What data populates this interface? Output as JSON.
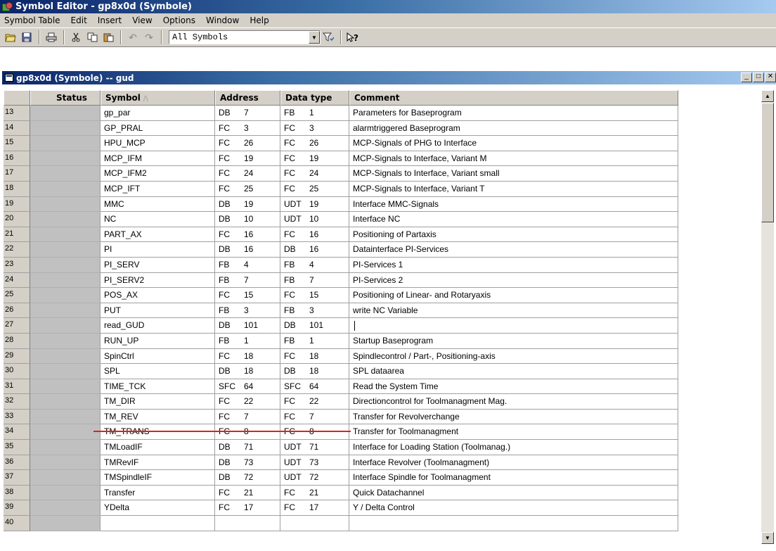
{
  "window": {
    "title": "Symbol Editor - gp8x0d (Symbole)"
  },
  "menu": [
    "Symbol Table",
    "Edit",
    "Insert",
    "View",
    "Options",
    "Window",
    "Help"
  ],
  "toolbar": {
    "filter_value": "All Symbols"
  },
  "child_window": {
    "title": "gp8x0d (Symbole) -- gud"
  },
  "table": {
    "headers": [
      "Status",
      "Symbol",
      "Address",
      "Data type",
      "Comment"
    ],
    "sort_indicator": "/\\",
    "rows": [
      {
        "num": "13",
        "symbol": "gp_par",
        "addr_type": "DB",
        "addr_no": "7",
        "dt_type": "FB",
        "dt_no": "1",
        "comment": "Parameters for Baseprogram"
      },
      {
        "num": "14",
        "symbol": "GP_PRAL",
        "addr_type": "FC",
        "addr_no": "3",
        "dt_type": "FC",
        "dt_no": "3",
        "comment": "alarmtriggered Baseprogram"
      },
      {
        "num": "15",
        "symbol": "HPU_MCP",
        "addr_type": "FC",
        "addr_no": "26",
        "dt_type": "FC",
        "dt_no": "26",
        "comment": "MCP-Signals of PHG to Interface"
      },
      {
        "num": "16",
        "symbol": "MCP_IFM",
        "addr_type": "FC",
        "addr_no": "19",
        "dt_type": "FC",
        "dt_no": "19",
        "comment": "MCP-Signals to Interface, Variant M"
      },
      {
        "num": "17",
        "symbol": "MCP_IFM2",
        "addr_type": "FC",
        "addr_no": "24",
        "dt_type": "FC",
        "dt_no": "24",
        "comment": "MCP-Signals to Interface, Variant small"
      },
      {
        "num": "18",
        "symbol": "MCP_IFT",
        "addr_type": "FC",
        "addr_no": "25",
        "dt_type": "FC",
        "dt_no": "25",
        "comment": "MCP-Signals to Interface, Variant T"
      },
      {
        "num": "19",
        "symbol": "MMC",
        "addr_type": "DB",
        "addr_no": "19",
        "dt_type": "UDT",
        "dt_no": "19",
        "comment": "Interface MMC-Signals"
      },
      {
        "num": "20",
        "symbol": "NC",
        "addr_type": "DB",
        "addr_no": "10",
        "dt_type": "UDT",
        "dt_no": "10",
        "comment": "Interface NC"
      },
      {
        "num": "21",
        "symbol": "PART_AX",
        "addr_type": "FC",
        "addr_no": "16",
        "dt_type": "FC",
        "dt_no": "16",
        "comment": "Positioning of Partaxis"
      },
      {
        "num": "22",
        "symbol": "PI",
        "addr_type": "DB",
        "addr_no": "16",
        "dt_type": "DB",
        "dt_no": "16",
        "comment": "Datainterface PI-Services"
      },
      {
        "num": "23",
        "symbol": "PI_SERV",
        "addr_type": "FB",
        "addr_no": "4",
        "dt_type": "FB",
        "dt_no": "4",
        "comment": "PI-Services 1"
      },
      {
        "num": "24",
        "symbol": "PI_SERV2",
        "addr_type": "FB",
        "addr_no": "7",
        "dt_type": "FB",
        "dt_no": "7",
        "comment": "PI-Services 2"
      },
      {
        "num": "25",
        "symbol": "POS_AX",
        "addr_type": "FC",
        "addr_no": "15",
        "dt_type": "FC",
        "dt_no": "15",
        "comment": "Positioning of Linear- and Rotaryaxis"
      },
      {
        "num": "26",
        "symbol": "PUT",
        "addr_type": "FB",
        "addr_no": "3",
        "dt_type": "FB",
        "dt_no": "3",
        "comment": "write NC Variable"
      },
      {
        "num": "27",
        "symbol": "read_GUD",
        "addr_type": "DB",
        "addr_no": "101",
        "dt_type": "DB",
        "dt_no": "101",
        "comment": ""
      },
      {
        "num": "28",
        "symbol": "RUN_UP",
        "addr_type": "FB",
        "addr_no": "1",
        "dt_type": "FB",
        "dt_no": "1",
        "comment": "Startup Baseprogram"
      },
      {
        "num": "29",
        "symbol": "SpinCtrl",
        "addr_type": "FC",
        "addr_no": "18",
        "dt_type": "FC",
        "dt_no": "18",
        "comment": "Spindlecontrol / Part-, Positioning-axis"
      },
      {
        "num": "30",
        "symbol": "SPL",
        "addr_type": "DB",
        "addr_no": "18",
        "dt_type": "DB",
        "dt_no": "18",
        "comment": "SPL dataarea"
      },
      {
        "num": "31",
        "symbol": "TIME_TCK",
        "addr_type": "SFC",
        "addr_no": "64",
        "dt_type": "SFC",
        "dt_no": "64",
        "comment": "Read the System Time"
      },
      {
        "num": "32",
        "symbol": "TM_DIR",
        "addr_type": "FC",
        "addr_no": "22",
        "dt_type": "FC",
        "dt_no": "22",
        "comment": "Directioncontrol for Toolmanagment Mag."
      },
      {
        "num": "33",
        "symbol": "TM_REV",
        "addr_type": "FC",
        "addr_no": "7",
        "dt_type": "FC",
        "dt_no": "7",
        "comment": "Transfer for Revolverchange"
      },
      {
        "num": "34",
        "symbol": "TM_TRANS",
        "addr_type": "FC",
        "addr_no": "8",
        "dt_type": "FC",
        "dt_no": "8",
        "comment": "Transfer for Toolmanagment"
      },
      {
        "num": "35",
        "symbol": "TMLoadIF",
        "addr_type": "DB",
        "addr_no": "71",
        "dt_type": "UDT",
        "dt_no": "71",
        "comment": "Interface for Loading Station (Toolmanag.)"
      },
      {
        "num": "36",
        "symbol": "TMRevIF",
        "addr_type": "DB",
        "addr_no": "73",
        "dt_type": "UDT",
        "dt_no": "73",
        "comment": "Interface Revolver (Toolmanagment)"
      },
      {
        "num": "37",
        "symbol": "TMSpindleIF",
        "addr_type": "DB",
        "addr_no": "72",
        "dt_type": "UDT",
        "dt_no": "72",
        "comment": "Interface Spindle for Toolmanagment"
      },
      {
        "num": "38",
        "symbol": "Transfer",
        "addr_type": "FC",
        "addr_no": "21",
        "dt_type": "FC",
        "dt_no": "21",
        "comment": "Quick Datachannel"
      },
      {
        "num": "39",
        "symbol": "YDelta",
        "addr_type": "FC",
        "addr_no": "17",
        "dt_type": "FC",
        "dt_no": "17",
        "comment": "Y / Delta Control"
      },
      {
        "num": "40",
        "symbol": "",
        "addr_type": "",
        "addr_no": "",
        "dt_type": "",
        "dt_no": "",
        "comment": ""
      }
    ]
  },
  "colors": {
    "title_bar": "#0a246a",
    "chrome": "#d4d0c8",
    "highlight_line": "#e02020"
  }
}
